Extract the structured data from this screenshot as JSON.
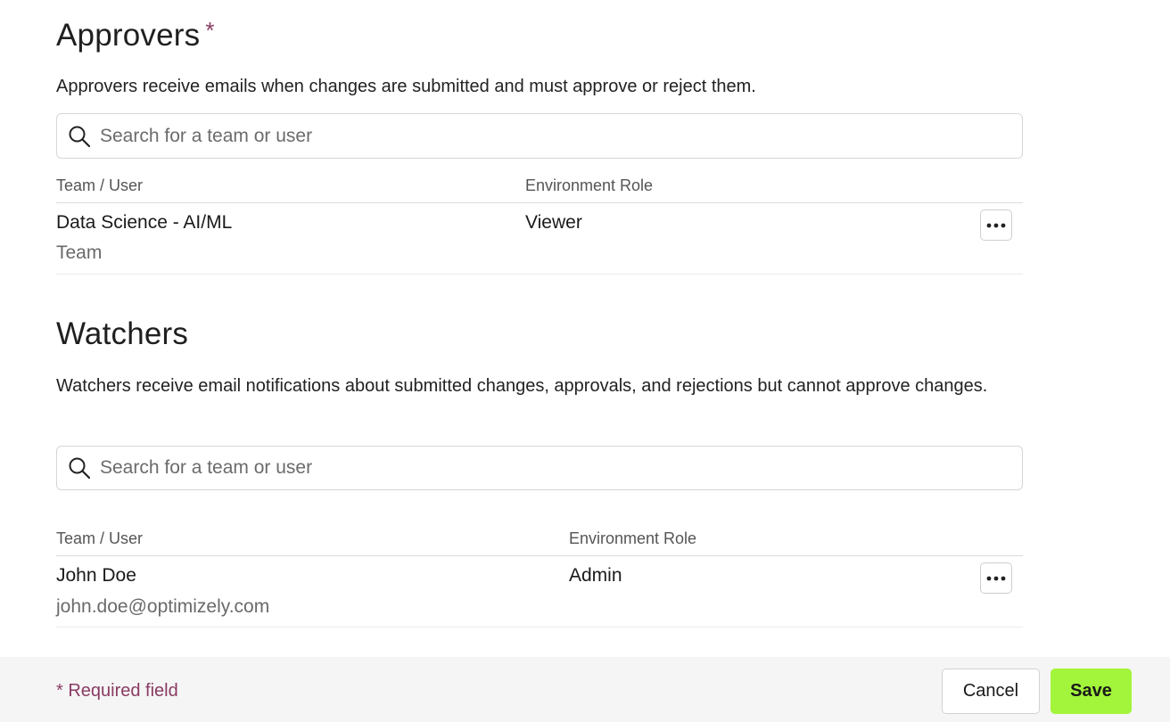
{
  "approvers": {
    "title": "Approvers",
    "required_marker": "*",
    "description": "Approvers receive emails when changes are submitted and must approve or reject them.",
    "search_placeholder": "Search for a team or user",
    "columns": {
      "team_user": "Team / User",
      "role": "Environment Role"
    },
    "rows": [
      {
        "name": "Data Science - AI/ML",
        "sub": "Team",
        "role": "Viewer"
      }
    ]
  },
  "watchers": {
    "title": "Watchers",
    "description": "Watchers receive email notifications about submitted changes, approvals, and rejections but cannot approve changes.",
    "search_placeholder": "Search for a team or user",
    "columns": {
      "team_user": "Team / User",
      "role": "Environment Role"
    },
    "rows": [
      {
        "name": "John Doe",
        "sub": "john.doe@optimizely.com",
        "role": "Admin"
      }
    ]
  },
  "footer": {
    "required_note": "* Required field",
    "cancel_label": "Cancel",
    "save_label": "Save"
  },
  "colors": {
    "accent_required": "#8a3b63",
    "save_button": "#a3f53b",
    "footer_bg": "#f5f5f5"
  },
  "icons": {
    "search": "search-icon",
    "more": "more-horizontal-icon"
  }
}
